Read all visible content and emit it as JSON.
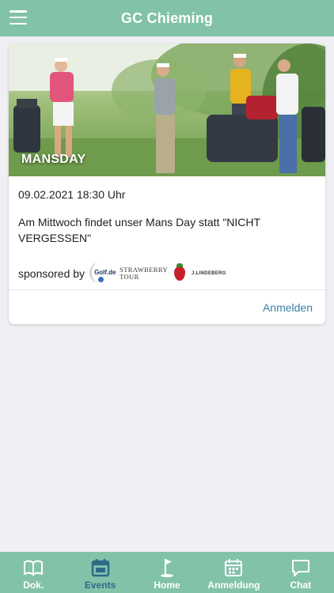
{
  "app": {
    "title": "GC Chieming"
  },
  "event": {
    "image_caption": "MANSDAY",
    "date": "09.02.2021 18:30 Uhr",
    "description": "Am Mittwoch findet unser Mans Day statt \"NICHT VERGESSEN\"",
    "sponsored_by_label": "sponsored by",
    "sponsors": {
      "golf_de": "Golf.de",
      "strawberry_line1": "STRAWBERRY",
      "strawberry_line2": "TOUR",
      "lindeberg": "J.LINDEBERG"
    },
    "register_label": "Anmelden"
  },
  "tabbar": {
    "active": "events",
    "items": [
      {
        "id": "dok",
        "label": "Dok.",
        "icon": "book-icon"
      },
      {
        "id": "events",
        "label": "Events",
        "icon": "calendar-icon"
      },
      {
        "id": "home",
        "label": "Home",
        "icon": "golf-flag-icon"
      },
      {
        "id": "anmeldung",
        "label": "Anmeldung",
        "icon": "calendar-grid-icon"
      },
      {
        "id": "chat",
        "label": "Chat",
        "icon": "chat-bubble-icon"
      }
    ]
  },
  "colors": {
    "header": "#82c2a9",
    "active_tab": "#2d6a86",
    "link": "#3d7fa6",
    "background": "#efeff4"
  }
}
